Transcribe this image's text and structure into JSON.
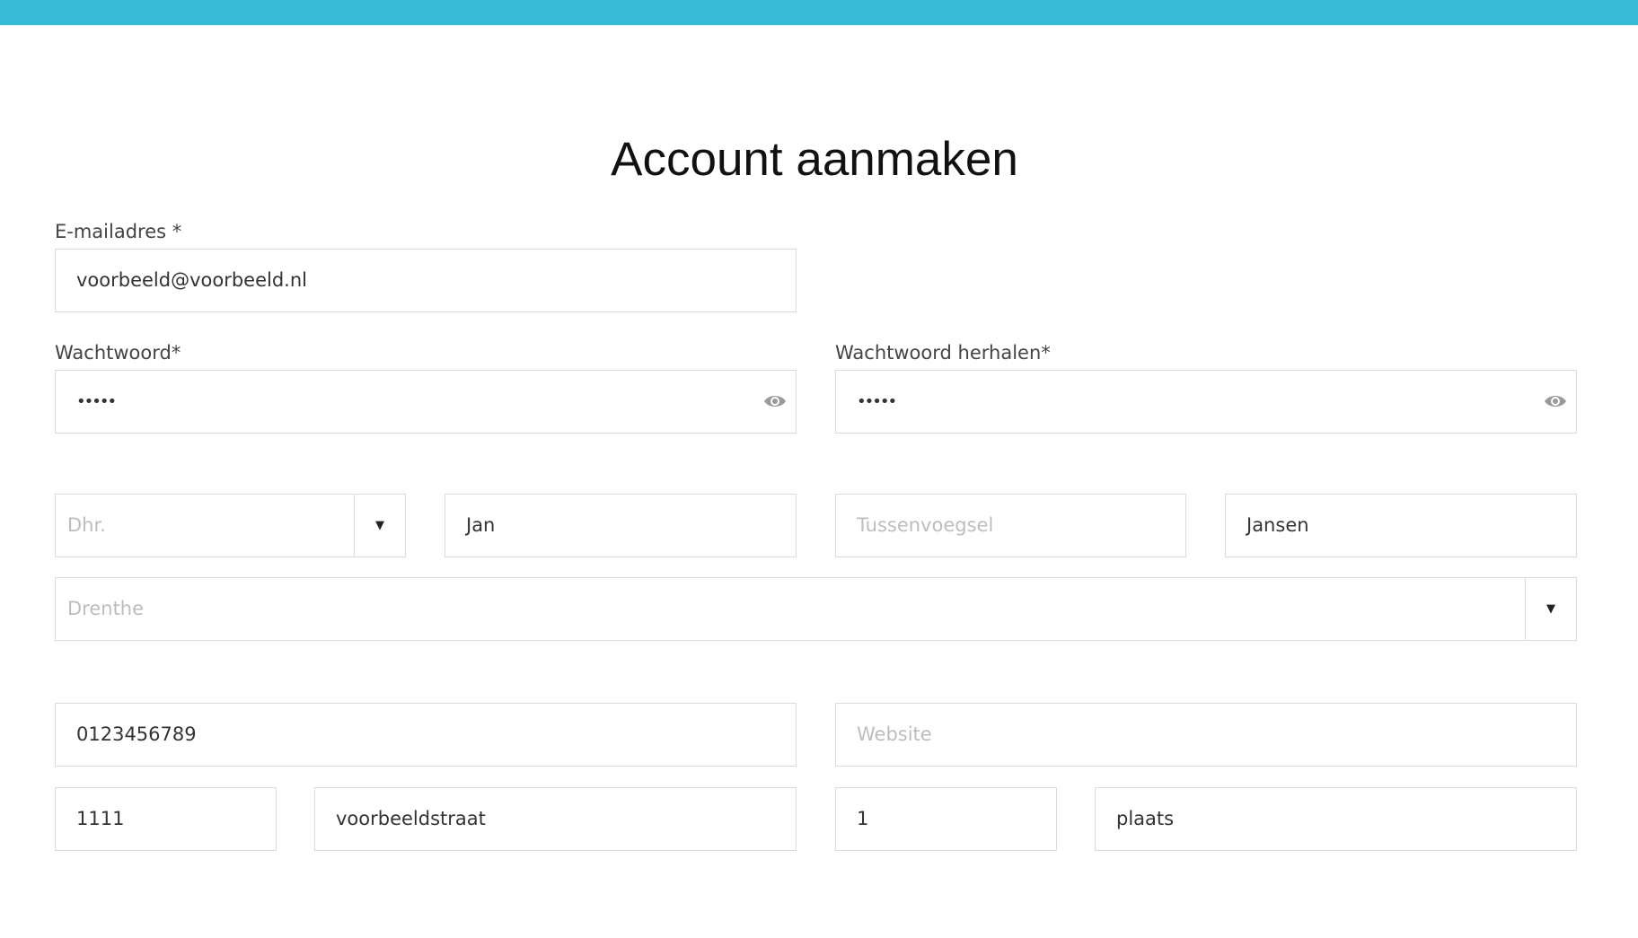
{
  "form": {
    "title": "Account aanmaken",
    "email": {
      "label": "E-mailadres *",
      "value": "voorbeeld@voorbeeld.nl"
    },
    "password": {
      "label": "Wachtwoord*",
      "value": "•••••"
    },
    "password_repeat": {
      "label": "Wachtwoord herhalen*",
      "value": "•••••"
    },
    "salutation": {
      "selected": "Dhr.",
      "arrow": "▼"
    },
    "first_name": {
      "value": "Jan"
    },
    "infix": {
      "placeholder": "Tussenvoegsel"
    },
    "last_name": {
      "value": "Jansen"
    },
    "province": {
      "selected": "Drenthe",
      "arrow": "▼"
    },
    "phone": {
      "value": "0123456789"
    },
    "website": {
      "placeholder": "Website"
    },
    "postal_code": {
      "value": "1111"
    },
    "street": {
      "value": "voorbeeldstraat"
    },
    "house_number": {
      "value": "1"
    },
    "city": {
      "value": "plaats"
    }
  },
  "icons": {
    "password_toggle": "eye-icon",
    "dropdown": "chevron-down-icon"
  },
  "colors": {
    "top_bar": "#37bad6",
    "border": "#dcdcdc",
    "placeholder": "#bdbdbd"
  }
}
